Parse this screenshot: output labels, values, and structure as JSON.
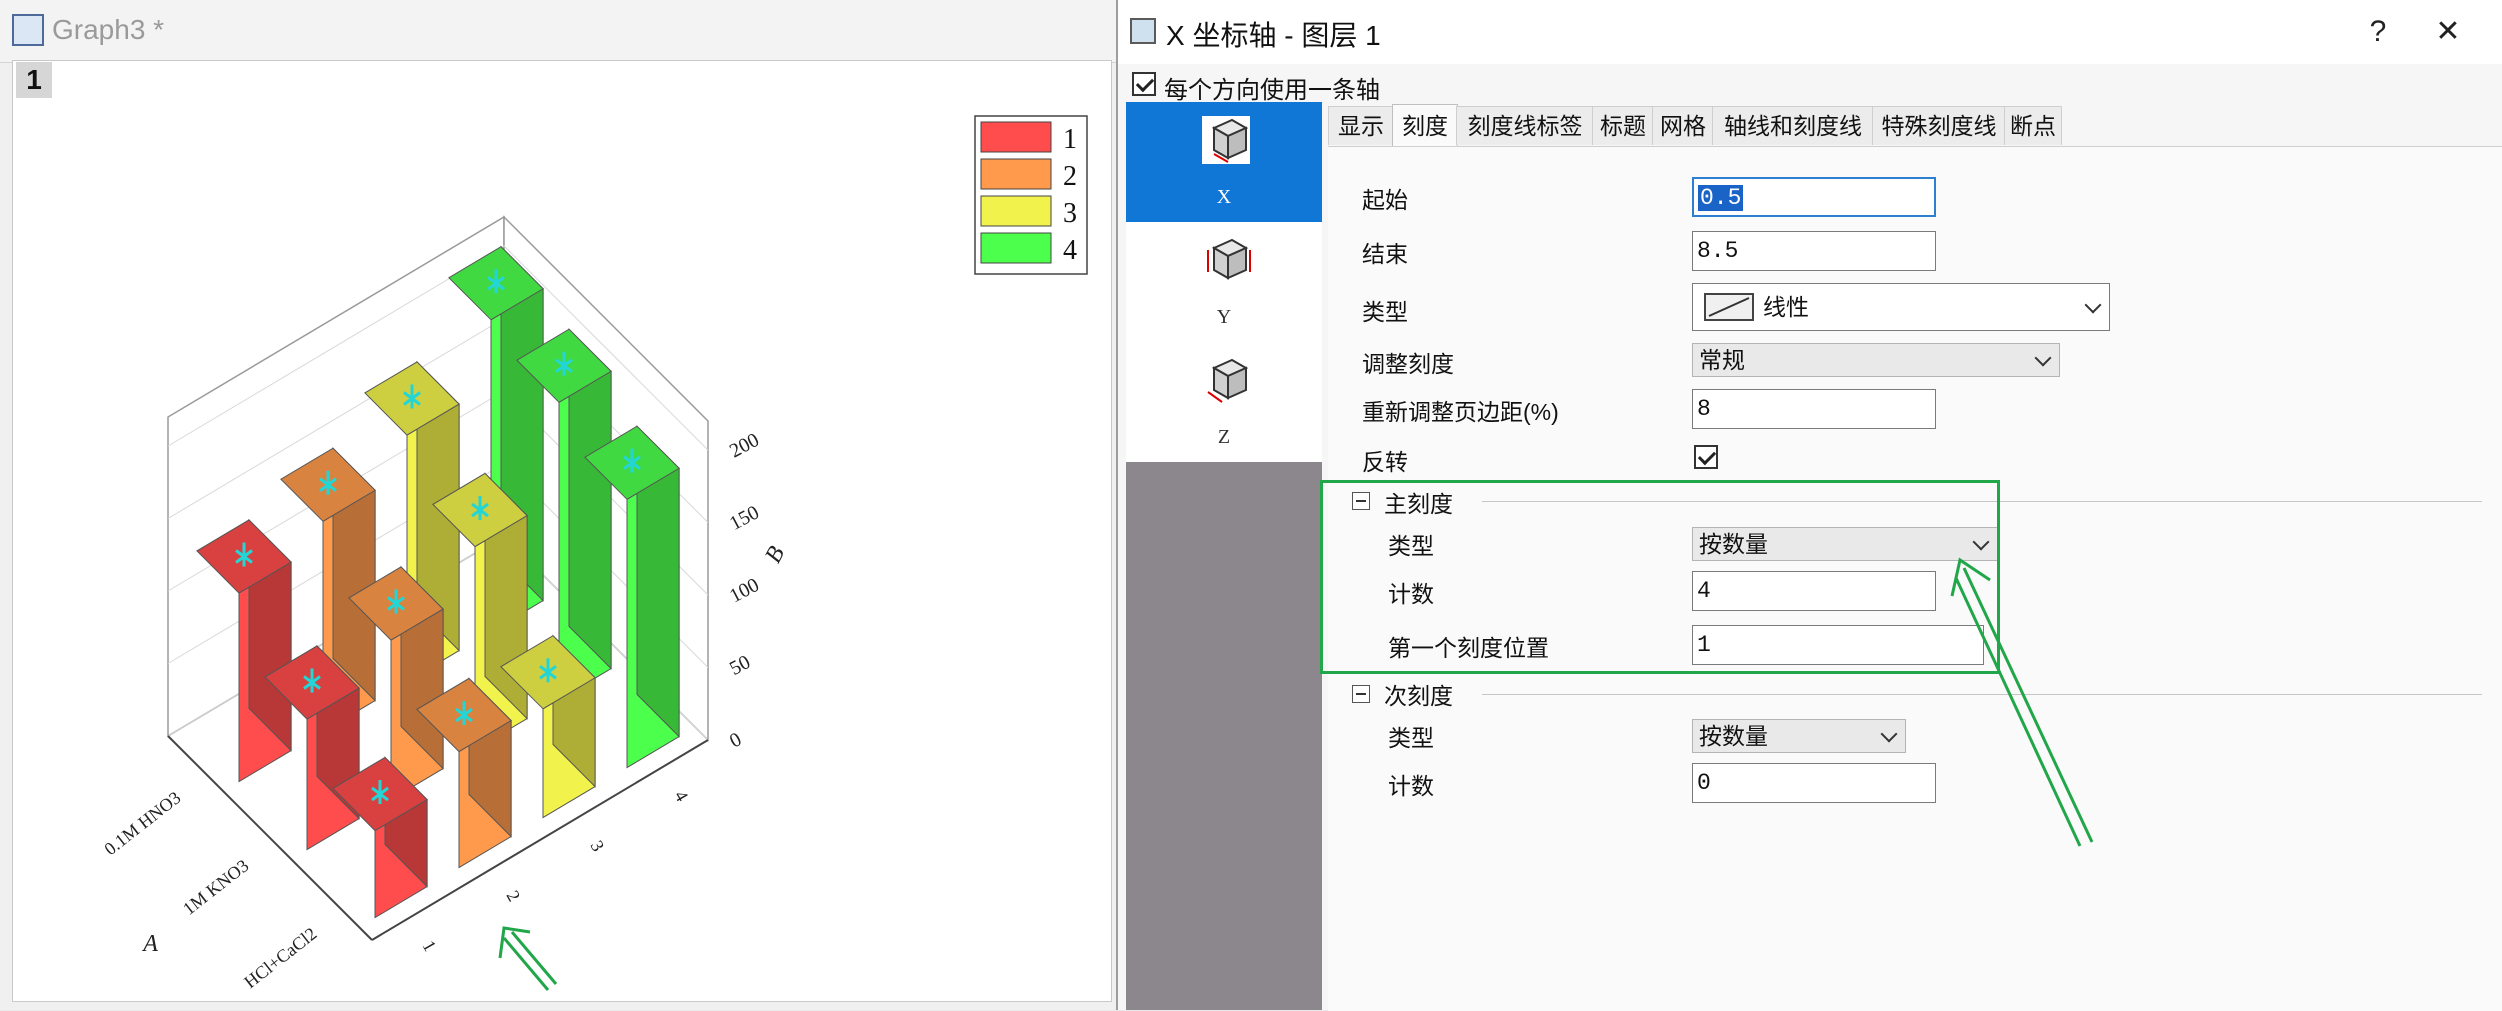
{
  "graph_window": {
    "title": "Graph3 *",
    "layer_label": "1"
  },
  "chart_data": {
    "type": "bar",
    "projection": "3D",
    "categories": [
      "1",
      "2",
      "3",
      "4"
    ],
    "rows": [
      "0.1M HNO3",
      "1M KNO3",
      "HCl+CaCl2"
    ],
    "series": [
      {
        "name": "1",
        "color": "#ff4d4d",
        "values": [
          130,
          90,
          60
        ]
      },
      {
        "name": "2",
        "color": "#ff9a4d",
        "values": [
          145,
          110,
          80
        ]
      },
      {
        "name": "3",
        "color": "#f2f24d",
        "values": [
          170,
          140,
          75
        ]
      },
      {
        "name": "4",
        "color": "#4dff4d",
        "values": [
          215,
          205,
          185
        ]
      }
    ],
    "xlabel": "A",
    "ylabel": "",
    "zlabel": "B",
    "zlim": [
      0,
      220
    ],
    "z_ticks": [
      "0",
      "50",
      "100",
      "150",
      "200"
    ],
    "x_tick_labels": [
      "0.1M HNO3",
      "1M KNO3",
      "HCl+CaCl2"
    ],
    "y_tick_labels": [
      "1",
      "2",
      "3",
      "4"
    ],
    "legend": [
      "1",
      "2",
      "3",
      "4"
    ],
    "legend_position": "top-right",
    "grid": true
  },
  "dialog": {
    "title": "X 坐标轴 - 图层 1",
    "help_label": "?",
    "close_label": "✕",
    "one_axis_per_direction": "每个方向使用一条轴",
    "axes": [
      {
        "label": "X",
        "selected": true
      },
      {
        "label": "Y",
        "selected": false
      },
      {
        "label": "Z",
        "selected": false
      }
    ],
    "tabs": [
      "显示",
      "刻度",
      "刻度线标签",
      "标题",
      "网格",
      "轴线和刻度线",
      "特殊刻度线",
      "断点"
    ],
    "active_tab": "刻度",
    "scale": {
      "start_label": "起始",
      "start_value": "0.5",
      "end_label": "结束",
      "end_value": "8.5",
      "type_label": "类型",
      "type_value": "线性",
      "rescale_label": "调整刻度",
      "rescale_value": "常规",
      "margin_label": "重新调整页边距(%)",
      "margin_value": "8",
      "reverse_label": "反转",
      "reverse_checked": true
    },
    "major_ticks": {
      "header": "主刻度",
      "type_label": "类型",
      "type_value": "按数量",
      "count_label": "计数",
      "count_value": "4",
      "first_label": "第一个刻度位置",
      "first_value": "1"
    },
    "minor_ticks": {
      "header": "次刻度",
      "type_label": "类型",
      "type_value": "按数量",
      "count_label": "计数",
      "count_value": "0"
    }
  },
  "colors": {
    "annotation_green": "#22a64a",
    "selection_blue": "#1177d6"
  }
}
